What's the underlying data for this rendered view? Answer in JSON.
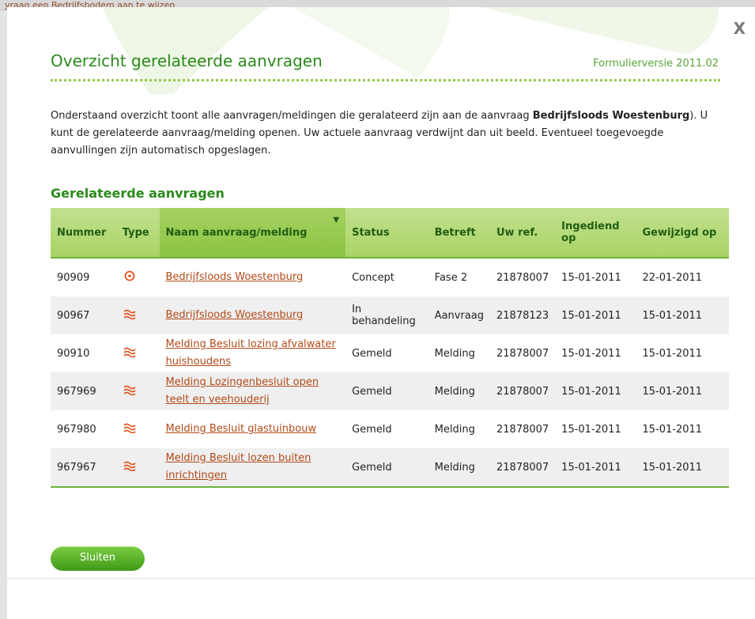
{
  "background": {
    "partial_text": "vraag een Bedrijfsbodem aan te wijzen"
  },
  "dialog": {
    "title": "Overzicht gerelateerde aanvragen",
    "version": "Formulierversie 2011.02",
    "close_label": "X",
    "intro_part1": "Onderstaand overzicht toont alle aanvragen/meldingen die geralateerd zijn aan de aanvraag ",
    "intro_bold": "Bedrijfsloods Woestenburg",
    "intro_part2": "). U kunt de gerelateerde aanvraag/melding openen. Uw actuele aanvraag verdwijnt dan uit beeld. Eventueel toegevoegde aanvullingen zijn automatisch opgeslagen.",
    "section_title": "Gerelateerde aanvragen",
    "close_button": "Sluiten"
  },
  "colors": {
    "accent_green": "#2a8a1a",
    "link_orange": "#b24a18",
    "header_green": "#a9d466"
  },
  "table": {
    "columns": [
      "Nummer",
      "Type",
      "Naam aanvraag/melding",
      "Status",
      "Betreft",
      "Uw ref.",
      "Ingediend op",
      "Gewijzigd op"
    ],
    "rows": [
      {
        "nummer": "90909",
        "type_icon": "target-icon",
        "naam": "Bedrijfsloods Woestenburg",
        "status": "Concept",
        "betreft": "Fase 2",
        "ref": "21878007",
        "ingediend": "15-01-2011",
        "gewijzigd": "22-01-2011"
      },
      {
        "nummer": "90967",
        "type_icon": "waves-icon",
        "naam": "Bedrijfsloods Woestenburg",
        "status": "In behandeling",
        "betreft": "Aanvraag",
        "ref": "21878123",
        "ingediend": "15-01-2011",
        "gewijzigd": "15-01-2011"
      },
      {
        "nummer": "90910",
        "type_icon": "waves-icon",
        "naam": "Melding Besluit lozing afvalwater huishoudens",
        "status": "Gemeld",
        "betreft": "Melding",
        "ref": "21878007",
        "ingediend": "15-01-2011",
        "gewijzigd": "15-01-2011"
      },
      {
        "nummer": "967969",
        "type_icon": "waves-icon",
        "naam": "Melding Lozingenbesluit open teelt en veehouderij",
        "status": "Gemeld",
        "betreft": "Melding",
        "ref": "21878007",
        "ingediend": "15-01-2011",
        "gewijzigd": "15-01-2011"
      },
      {
        "nummer": "967980",
        "type_icon": "waves-icon",
        "naam": "Melding Besluit glastuinbouw",
        "status": "Gemeld",
        "betreft": "Melding",
        "ref": "21878007",
        "ingediend": "15-01-2011",
        "gewijzigd": "15-01-2011"
      },
      {
        "nummer": "967967",
        "type_icon": "waves-icon",
        "naam": "Melding Besluit lozen buiten inrichtingen",
        "status": "Gemeld",
        "betreft": "Melding",
        "ref": "21878007",
        "ingediend": "15-01-2011",
        "gewijzigd": "15-01-2011"
      }
    ]
  }
}
